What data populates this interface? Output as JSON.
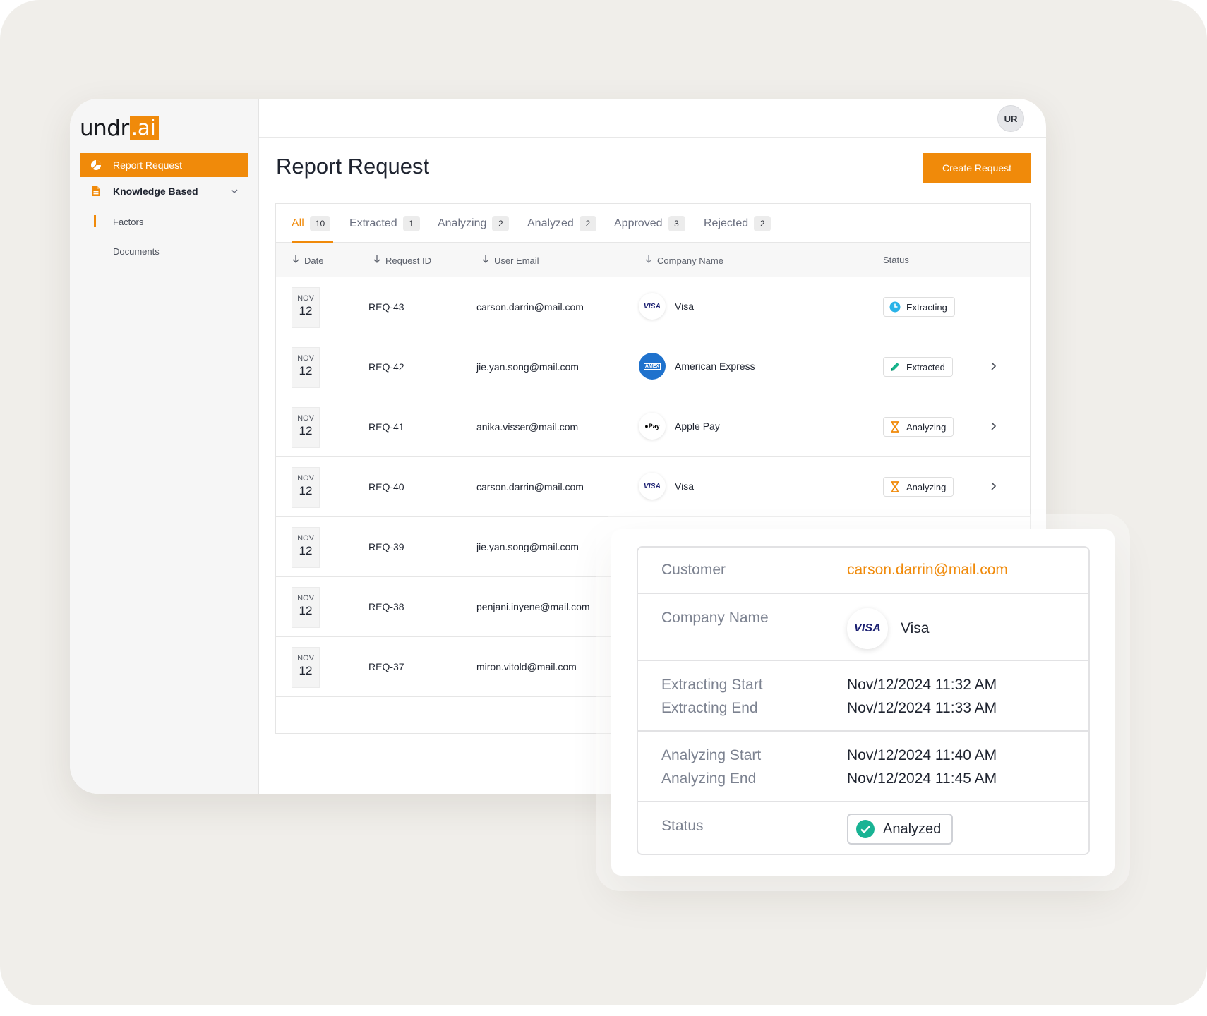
{
  "brand": {
    "logo_prefix": "undr",
    "logo_suffix": ".ai",
    "accent": "#f08a0a"
  },
  "sidebar": {
    "items": [
      {
        "label": "Report Request",
        "icon": "pie-chart-icon",
        "active": true
      },
      {
        "label": "Knowledge Based",
        "icon": "document-icon",
        "expandable": true
      }
    ],
    "subitems": [
      {
        "label": "Factors",
        "active": true
      },
      {
        "label": "Documents"
      }
    ]
  },
  "topbar": {
    "avatar_initials": "UR"
  },
  "page": {
    "title": "Report Request",
    "create_button": "Create Request"
  },
  "tabs": [
    {
      "label": "All",
      "count": "10",
      "active": true
    },
    {
      "label": "Extracted",
      "count": "1"
    },
    {
      "label": "Analyzing",
      "count": "2"
    },
    {
      "label": "Analyzed",
      "count": "2"
    },
    {
      "label": "Approved",
      "count": "3"
    },
    {
      "label": "Rejected",
      "count": "2"
    }
  ],
  "table": {
    "columns": [
      "Date",
      "Request ID",
      "User Email",
      "Company Name",
      "Status"
    ],
    "rows": [
      {
        "month": "NOV",
        "day": "12",
        "id": "REQ-43",
        "email": "carson.darrin@mail.com",
        "company": "Visa",
        "logo": "visa",
        "status": "Extracting",
        "status_icon": "clock-icon"
      },
      {
        "month": "NOV",
        "day": "12",
        "id": "REQ-42",
        "email": "jie.yan.song@mail.com",
        "company": "American Express",
        "logo": "amex",
        "status": "Extracted",
        "status_icon": "pencil-icon"
      },
      {
        "month": "NOV",
        "day": "12",
        "id": "REQ-41",
        "email": "anika.visser@mail.com",
        "company": "Apple Pay",
        "logo": "applepay",
        "status": "Analyzing",
        "status_icon": "hourglass-icon"
      },
      {
        "month": "NOV",
        "day": "12",
        "id": "REQ-40",
        "email": "carson.darrin@mail.com",
        "company": "Visa",
        "logo": "visa",
        "status": "Analyzing",
        "status_icon": "hourglass-icon"
      },
      {
        "month": "NOV",
        "day": "12",
        "id": "REQ-39",
        "email": "jie.yan.song@mail.com"
      },
      {
        "month": "NOV",
        "day": "12",
        "id": "REQ-38",
        "email": "penjani.inyene@mail.com"
      },
      {
        "month": "NOV",
        "day": "12",
        "id": "REQ-37",
        "email": "miron.vitold@mail.com"
      }
    ]
  },
  "logos": {
    "visa": "VISA",
    "amex": "AMEX",
    "applepay": "Pay"
  },
  "detail": {
    "customer_label": "Customer",
    "customer_value": "carson.darrin@mail.com",
    "company_label": "Company Name",
    "company_value": "Visa",
    "company_logo": "VISA",
    "extracting_start_label": "Extracting Start",
    "extracting_start_value": "Nov/12/2024 11:32 AM",
    "extracting_end_label": "Extracting End",
    "extracting_end_value": "Nov/12/2024 11:33 AM",
    "analyzing_start_label": "Analyzing Start",
    "analyzing_start_value": "Nov/12/2024 11:40 AM",
    "analyzing_end_label": "Analyzing End",
    "analyzing_end_value": "Nov/12/2024 11:45 AM",
    "status_label": "Status",
    "status_value": "Analyzed"
  }
}
